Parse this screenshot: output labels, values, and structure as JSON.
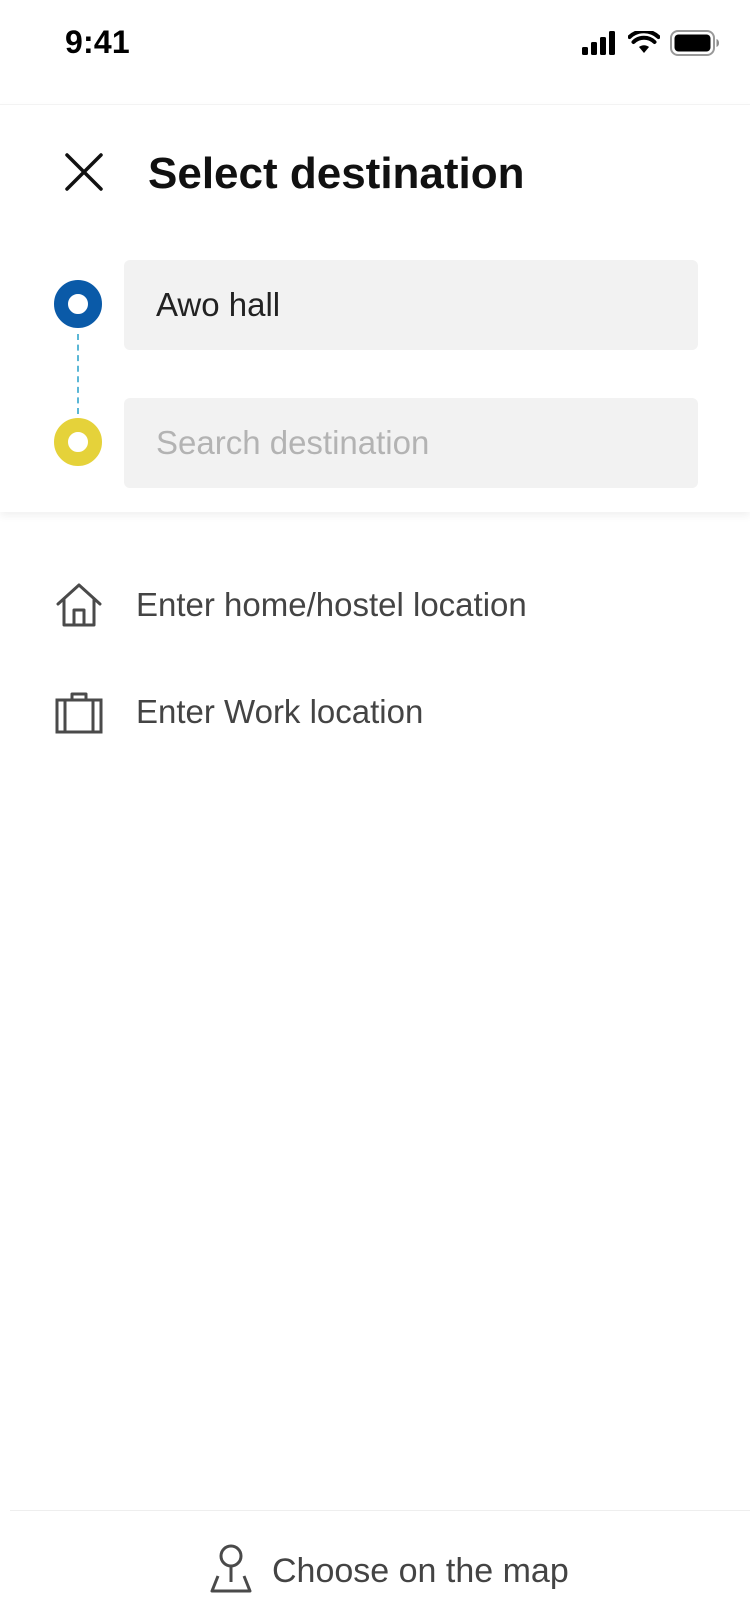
{
  "status_bar": {
    "time": "9:41",
    "icons": [
      "cellular-signal-icon",
      "wifi-icon",
      "battery-icon"
    ]
  },
  "header": {
    "title": "Select destination",
    "close_icon": "close-icon"
  },
  "route": {
    "origin": {
      "value": "Awo hall",
      "dot_color": "#0a5aa8"
    },
    "destination": {
      "value": "",
      "placeholder": "Search destination",
      "dot_color": "#e5d23a"
    },
    "connector_color": "#5bb7d6"
  },
  "shortcuts": [
    {
      "icon": "home-icon",
      "label": "Enter home/hostel location"
    },
    {
      "icon": "briefcase-icon",
      "label": "Enter Work location"
    }
  ],
  "footer": {
    "icon": "map-pin-icon",
    "label": "Choose on the map"
  }
}
